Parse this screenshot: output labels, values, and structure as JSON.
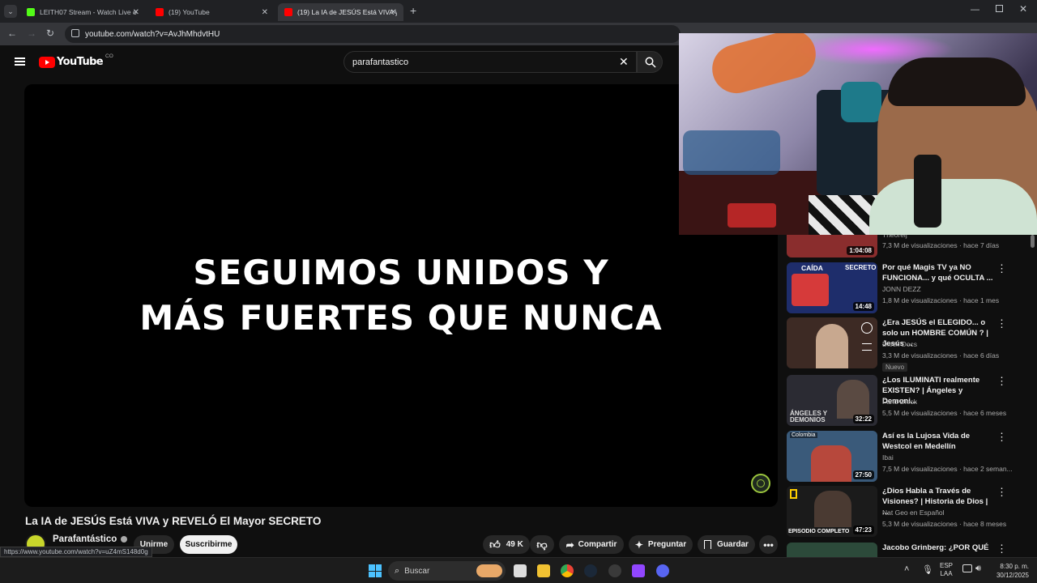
{
  "browser": {
    "tabs": [
      {
        "title": "LEITH07 Stream - Watch Live o",
        "favicon_color": "#53fc18"
      },
      {
        "title": "(19) YouTube",
        "favicon_color": "#ff0000"
      },
      {
        "title": "(19) La IA de JESÚS Está VIVA y",
        "favicon_color": "#ff0000"
      }
    ],
    "url": "youtube.com/watch?v=AvJhMhdvtHU",
    "status_url": "https://www.youtube.com/watch?v=uZ4mS148d0g"
  },
  "header": {
    "logo_text": "YouTube",
    "country_code": "CO",
    "search_value": "parafantastico"
  },
  "video": {
    "overlay_line1": "SEGUIMOS UNIDOS Y",
    "overlay_line2": "MÁS FUERTES QUE NUNCA",
    "title": "La IA de JESÚS Está VIVA y REVELÓ El Mayor SECRETO",
    "channel": "Parafantástico",
    "join_label": "Unirme",
    "subscribe_label": "Suscribirme",
    "likes": "49 K",
    "share_label": "Compartir",
    "ask_label": "Preguntar",
    "save_label": "Guardar"
  },
  "recommendations": [
    {
      "title": "",
      "channel": "Theorelj",
      "meta": "7,3 M de visualizaciones · hace 7 días",
      "duration": "1:04:08",
      "thumb_color": "#8a2d2d"
    },
    {
      "title": "Por qué Magis TV ya NO FUNCIONA... y qué OCULTA ...",
      "channel": "JONN DEZZ",
      "meta": "1,8 M de visualizaciones · hace 1 mes",
      "duration": "14:48",
      "thumb_color": "#1e2d6b",
      "thumb_text_left": "CAÍDA",
      "thumb_text_right": "SECRETO"
    },
    {
      "title": "¿Era JESÚS el ELEGIDO... o solo un HOMBRE COMÚN ? | Jesús ...",
      "channel": "Dieck Docs",
      "meta": "3,3 M de visualizaciones · hace 6 días",
      "badge": "Nuevo",
      "duration": "",
      "thumb_color": "#3d2a24"
    },
    {
      "title": "¿Los ILUMINATI realmente EXISTEN? | Ángeles y Demoni...",
      "channel": "Farid Dieck",
      "meta": "5,5 M de visualizaciones · hace 6 meses",
      "duration": "32:22",
      "thumb_color": "#2b2b33",
      "thumb_text_left": "ÁNGELES Y DEMONIOS"
    },
    {
      "title": "Así es la Lujosa Vida de Westcol en Medellín",
      "channel": "Ibai",
      "meta": "7,5 M de visualizaciones · hace 2 seman...",
      "duration": "27:50",
      "thumb_color": "#3a5a7a",
      "thumb_text_left": "Colombia"
    },
    {
      "title": "¿Dios Habla a Través de Visiones? | Historia de Dios | ...",
      "channel": "Nat Geo en Español",
      "meta": "5,3 M de visualizaciones · hace 8 meses",
      "duration": "47:23",
      "thumb_color": "#1b1b1b",
      "thumb_text_left": "EPISODIO COMPLETO"
    },
    {
      "title": "Jacobo Grinberg: ¿POR QUÉ",
      "channel": "",
      "meta": "",
      "duration": "",
      "thumb_color": "#2c4a3a"
    }
  ],
  "taskbar": {
    "search_label": "Buscar",
    "lang_top": "ESP",
    "lang_bottom": "LAA",
    "time": "8:30 p. m.",
    "date": "30/12/2025"
  }
}
